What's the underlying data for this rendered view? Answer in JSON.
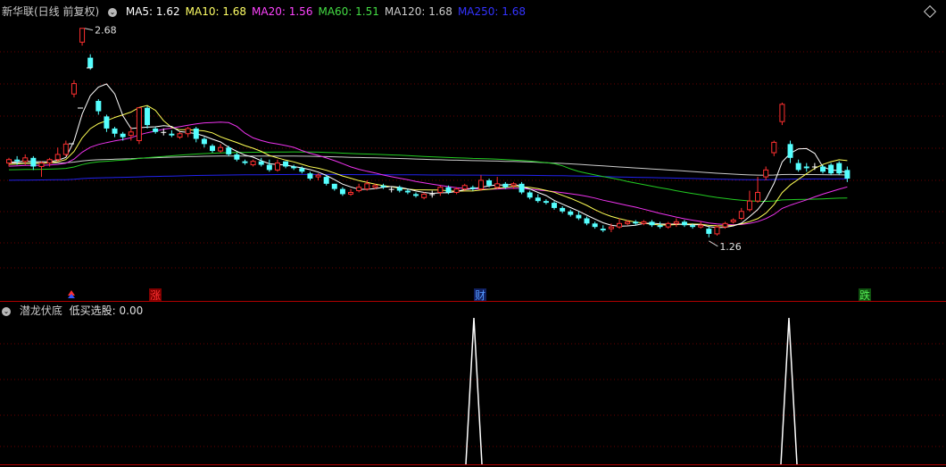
{
  "header": {
    "stock": "新华联(日线 前复权)",
    "ma_labels": [
      {
        "text": "MA5: 1.62",
        "color": "#ffffff"
      },
      {
        "text": "MA10: 1.68",
        "color": "#ffff66"
      },
      {
        "text": "MA20: 1.56",
        "color": "#ff44ff"
      },
      {
        "text": "MA60: 1.51",
        "color": "#44dd44"
      },
      {
        "text": "MA120: 1.68",
        "color": "#cccccc"
      },
      {
        "text": "MA250: 1.68",
        "color": "#3333ff"
      }
    ]
  },
  "indicator": {
    "name": "潜龙伏底",
    "value_label": "低买选股: 0.00"
  },
  "chart_data": {
    "type": "candlestick",
    "high_label": "2.68",
    "low_label": "1.26",
    "signals": [
      "涨",
      "财",
      "跌"
    ],
    "candles": [
      [
        1.9,
        1.92,
        1.88,
        1.93
      ],
      [
        1.92,
        1.91,
        1.89,
        1.94
      ],
      [
        1.91,
        1.93,
        1.89,
        1.95
      ],
      [
        1.93,
        1.88,
        1.86,
        1.94
      ],
      [
        1.88,
        1.9,
        1.82,
        1.91
      ],
      [
        1.9,
        1.92,
        1.88,
        1.93
      ],
      [
        1.92,
        1.95,
        1.91,
        1.99
      ],
      [
        1.95,
        2.01,
        1.94,
        2.03
      ],
      [
        2.3,
        2.36,
        2.28,
        2.38
      ],
      [
        2.6,
        2.68,
        2.58,
        2.68
      ],
      [
        2.51,
        2.45,
        2.44,
        2.53
      ],
      [
        2.26,
        2.2,
        2.18,
        2.27
      ],
      [
        2.17,
        2.1,
        2.08,
        2.18
      ],
      [
        2.1,
        2.07,
        2.05,
        2.11
      ],
      [
        2.07,
        2.05,
        2.03,
        2.08
      ],
      [
        2.06,
        2.08,
        2.03,
        2.11
      ],
      [
        2.03,
        2.22,
        2.01,
        2.22
      ],
      [
        2.22,
        2.12,
        2.1,
        2.23
      ],
      [
        2.1,
        2.08,
        2.07,
        2.11
      ],
      [
        2.08,
        2.08,
        2.06,
        2.1
      ],
      [
        2.07,
        2.06,
        2.05,
        2.09
      ],
      [
        2.05,
        2.07,
        2.04,
        2.08
      ],
      [
        2.07,
        2.1,
        2.05,
        2.11
      ],
      [
        2.1,
        2.04,
        2.02,
        2.11
      ],
      [
        2.04,
        2.01,
        1.99,
        2.05
      ],
      [
        2.0,
        1.97,
        1.96,
        2.01
      ],
      [
        1.97,
        1.99,
        1.96,
        2.01
      ],
      [
        1.99,
        1.95,
        1.94,
        2.0
      ],
      [
        1.95,
        1.92,
        1.91,
        1.96
      ],
      [
        1.91,
        1.9,
        1.89,
        1.92
      ],
      [
        1.89,
        1.91,
        1.88,
        1.92
      ],
      [
        1.91,
        1.89,
        1.88,
        1.93
      ],
      [
        1.89,
        1.86,
        1.85,
        1.92
      ],
      [
        1.86,
        1.9,
        1.85,
        1.92
      ],
      [
        1.91,
        1.88,
        1.87,
        1.91
      ],
      [
        1.88,
        1.87,
        1.86,
        1.89
      ],
      [
        1.87,
        1.85,
        1.84,
        1.88
      ],
      [
        1.84,
        1.81,
        1.8,
        1.85
      ],
      [
        1.82,
        1.83,
        1.8,
        1.84
      ],
      [
        1.82,
        1.78,
        1.77,
        1.83
      ],
      [
        1.78,
        1.75,
        1.74,
        1.78
      ],
      [
        1.75,
        1.72,
        1.71,
        1.76
      ],
      [
        1.72,
        1.73,
        1.71,
        1.75
      ],
      [
        1.74,
        1.76,
        1.73,
        1.78
      ],
      [
        1.75,
        1.78,
        1.74,
        1.8
      ],
      [
        1.76,
        1.77,
        1.75,
        1.78
      ],
      [
        1.77,
        1.76,
        1.75,
        1.78
      ],
      [
        1.75,
        1.75,
        1.73,
        1.76
      ],
      [
        1.76,
        1.74,
        1.73,
        1.77
      ],
      [
        1.74,
        1.73,
        1.72,
        1.75
      ],
      [
        1.72,
        1.71,
        1.7,
        1.73
      ],
      [
        1.7,
        1.72,
        1.69,
        1.73
      ],
      [
        1.72,
        1.72,
        1.7,
        1.74
      ],
      [
        1.73,
        1.76,
        1.71,
        1.77
      ],
      [
        1.76,
        1.73,
        1.72,
        1.77
      ],
      [
        1.73,
        1.75,
        1.72,
        1.76
      ],
      [
        1.75,
        1.77,
        1.74,
        1.78
      ],
      [
        1.76,
        1.75,
        1.74,
        1.77
      ],
      [
        1.75,
        1.8,
        1.74,
        1.83
      ],
      [
        1.8,
        1.77,
        1.76,
        1.81
      ],
      [
        1.76,
        1.78,
        1.75,
        1.82
      ],
      [
        1.78,
        1.76,
        1.75,
        1.79
      ],
      [
        1.77,
        1.78,
        1.75,
        1.79
      ],
      [
        1.78,
        1.73,
        1.72,
        1.79
      ],
      [
        1.73,
        1.7,
        1.69,
        1.74
      ],
      [
        1.7,
        1.68,
        1.67,
        1.72
      ],
      [
        1.68,
        1.67,
        1.66,
        1.69
      ],
      [
        1.67,
        1.64,
        1.63,
        1.68
      ],
      [
        1.64,
        1.62,
        1.61,
        1.65
      ],
      [
        1.62,
        1.6,
        1.59,
        1.63
      ],
      [
        1.6,
        1.58,
        1.57,
        1.62
      ],
      [
        1.58,
        1.55,
        1.54,
        1.59
      ],
      [
        1.55,
        1.53,
        1.52,
        1.56
      ],
      [
        1.52,
        1.51,
        1.5,
        1.54
      ],
      [
        1.52,
        1.53,
        1.5,
        1.55
      ],
      [
        1.53,
        1.55,
        1.52,
        1.58
      ],
      [
        1.55,
        1.56,
        1.54,
        1.57
      ],
      [
        1.56,
        1.55,
        1.54,
        1.57
      ],
      [
        1.55,
        1.56,
        1.54,
        1.57
      ],
      [
        1.56,
        1.54,
        1.53,
        1.57
      ],
      [
        1.54,
        1.53,
        1.52,
        1.56
      ],
      [
        1.53,
        1.55,
        1.52,
        1.56
      ],
      [
        1.55,
        1.56,
        1.53,
        1.58
      ],
      [
        1.56,
        1.54,
        1.53,
        1.57
      ],
      [
        1.54,
        1.53,
        1.52,
        1.55
      ],
      [
        1.53,
        1.54,
        1.52,
        1.56
      ],
      [
        1.52,
        1.49,
        1.47,
        1.53
      ],
      [
        1.49,
        1.53,
        1.48,
        1.54
      ],
      [
        1.53,
        1.55,
        1.52,
        1.56
      ],
      [
        1.56,
        1.57,
        1.55,
        1.58
      ],
      [
        1.58,
        1.62,
        1.57,
        1.64
      ],
      [
        1.63,
        1.68,
        1.62,
        1.74
      ],
      [
        1.68,
        1.73,
        1.67,
        1.82
      ],
      [
        1.82,
        1.86,
        1.8,
        1.88
      ],
      [
        1.96,
        2.02,
        1.94,
        2.03
      ],
      [
        2.14,
        2.24,
        2.12,
        2.25
      ],
      [
        2.01,
        1.93,
        1.9,
        2.03
      ],
      [
        1.9,
        1.86,
        1.85,
        1.92
      ],
      [
        1.88,
        1.87,
        1.85,
        1.9
      ],
      [
        1.88,
        1.88,
        1.86,
        1.9
      ],
      [
        1.88,
        1.85,
        1.84,
        1.89
      ],
      [
        1.89,
        1.84,
        1.83,
        1.9
      ],
      [
        1.9,
        1.84,
        1.83,
        1.91
      ],
      [
        1.86,
        1.81,
        1.79,
        1.88
      ]
    ]
  }
}
